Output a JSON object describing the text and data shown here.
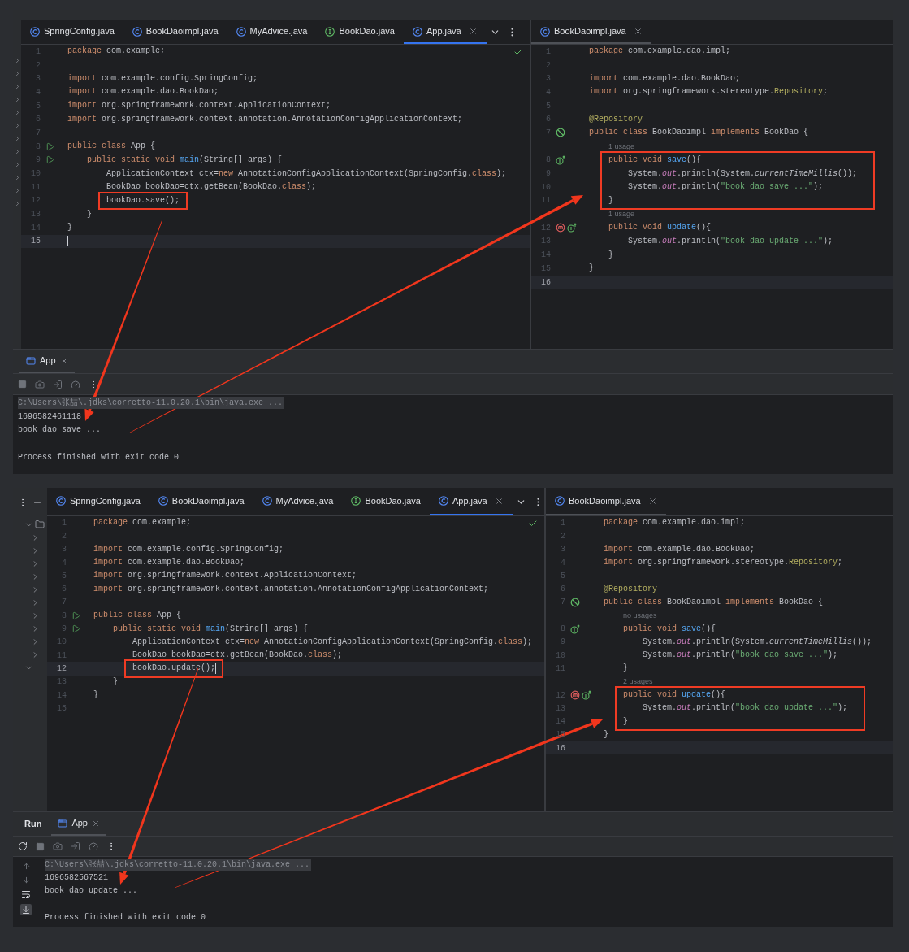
{
  "screens": [
    {
      "project_panel": {
        "kind": "narrow"
      },
      "left_editor": {
        "focused": true,
        "status_ok": true,
        "tabs": [
          {
            "label": "SpringConfig.java",
            "kind": "class",
            "selected": false
          },
          {
            "label": "BookDaoimpl.java",
            "kind": "class",
            "selected": false
          },
          {
            "label": "MyAdvice.java",
            "kind": "class",
            "selected": false
          },
          {
            "label": "BookDao.java",
            "kind": "interface",
            "selected": false
          },
          {
            "label": "App.java",
            "kind": "class",
            "selected": true
          }
        ],
        "lines": [
          {
            "kind": "code",
            "number": "1",
            "current": false,
            "boxed": false,
            "segments": [
              {
                "kind": "kw",
                "text": "package "
              },
              {
                "kind": "plain",
                "text": "com.example;"
              }
            ]
          },
          {
            "kind": "code",
            "number": "2",
            "current": false,
            "boxed": false
          },
          {
            "kind": "code",
            "number": "3",
            "current": false,
            "boxed": false,
            "segments": [
              {
                "kind": "kw",
                "text": "import "
              },
              {
                "kind": "plain",
                "text": "com.example.config.SpringConfig;"
              }
            ]
          },
          {
            "kind": "code",
            "number": "4",
            "current": false,
            "boxed": false,
            "segments": [
              {
                "kind": "kw",
                "text": "import "
              },
              {
                "kind": "plain",
                "text": "com.example.dao.BookDao;"
              }
            ]
          },
          {
            "kind": "code",
            "number": "5",
            "current": false,
            "boxed": false,
            "segments": [
              {
                "kind": "kw",
                "text": "import "
              },
              {
                "kind": "plain",
                "text": "org.springframework.context.ApplicationContext;"
              }
            ]
          },
          {
            "kind": "code",
            "number": "6",
            "current": false,
            "boxed": false,
            "segments": [
              {
                "kind": "kw",
                "text": "import "
              },
              {
                "kind": "plain",
                "text": "org.springframework.context.annotation.AnnotationConfigApplicationContext;"
              }
            ]
          },
          {
            "kind": "code",
            "number": "7",
            "current": false,
            "boxed": false
          },
          {
            "kind": "code",
            "number": "8",
            "current": false,
            "boxed": false,
            "gutter": [
              {
                "kind": "run"
              }
            ],
            "segments": [
              {
                "kind": "kw",
                "text": "public class "
              },
              {
                "kind": "plain",
                "text": "App {"
              }
            ]
          },
          {
            "kind": "code",
            "number": "9",
            "current": false,
            "boxed": false,
            "gutter": [
              {
                "kind": "run"
              }
            ],
            "segments": [
              {
                "kind": "kw",
                "text": "    public static void "
              },
              {
                "kind": "fn",
                "text": "main"
              },
              {
                "kind": "plain",
                "text": "(String[] args) {"
              }
            ]
          },
          {
            "kind": "code",
            "number": "10",
            "current": false,
            "boxed": false,
            "segments": [
              {
                "kind": "plain",
                "text": "        ApplicationContext ctx="
              },
              {
                "kind": "kw",
                "text": "new "
              },
              {
                "kind": "plain",
                "text": "AnnotationConfigApplicationContext(SpringConfig."
              },
              {
                "kind": "kw",
                "text": "class"
              },
              {
                "kind": "plain",
                "text": ");"
              }
            ]
          },
          {
            "kind": "code",
            "number": "11",
            "current": false,
            "boxed": false,
            "segments": [
              {
                "kind": "plain",
                "text": "        BookDao bookDao=ctx.getBean(BookDao."
              },
              {
                "kind": "kw",
                "text": "class"
              },
              {
                "kind": "plain",
                "text": ");"
              }
            ]
          },
          {
            "kind": "code",
            "number": "12",
            "current": false,
            "boxed": true,
            "segments": [
              {
                "kind": "plain",
                "text": "        bookDao.save();"
              }
            ]
          },
          {
            "kind": "code",
            "number": "13",
            "current": false,
            "boxed": false,
            "segments": [
              {
                "kind": "plain",
                "text": "    }"
              }
            ]
          },
          {
            "kind": "code",
            "number": "14",
            "current": false,
            "boxed": false,
            "segments": [
              {
                "kind": "plain",
                "text": "}"
              }
            ]
          },
          {
            "kind": "code",
            "number": "15",
            "current": true,
            "boxed": false
          }
        ]
      },
      "right_editor": {
        "focused": false,
        "status_ok": false,
        "tabs": [
          {
            "label": "BookDaoimpl.java",
            "kind": "class",
            "selected": true
          }
        ],
        "lines": [
          {
            "kind": "code",
            "number": "1",
            "current": false,
            "boxed": false,
            "segments": [
              {
                "kind": "kw",
                "text": "package "
              },
              {
                "kind": "plain",
                "text": "com.example.dao.impl;"
              }
            ]
          },
          {
            "kind": "code",
            "number": "2",
            "current": false,
            "boxed": false
          },
          {
            "kind": "code",
            "number": "3",
            "current": false,
            "boxed": false,
            "segments": [
              {
                "kind": "kw",
                "text": "import "
              },
              {
                "kind": "plain",
                "text": "com.example.dao.BookDao;"
              }
            ]
          },
          {
            "kind": "code",
            "number": "4",
            "current": false,
            "boxed": false,
            "segments": [
              {
                "kind": "kw",
                "text": "import "
              },
              {
                "kind": "plain",
                "text": "org.springframework.stereotype."
              },
              {
                "kind": "ann",
                "text": "Repository"
              },
              {
                "kind": "plain",
                "text": ";"
              }
            ]
          },
          {
            "kind": "code",
            "number": "5",
            "current": false,
            "boxed": false
          },
          {
            "kind": "code",
            "number": "6",
            "current": false,
            "boxed": false,
            "segments": [
              {
                "kind": "ann",
                "text": "@Repository"
              }
            ]
          },
          {
            "kind": "code",
            "number": "7",
            "current": false,
            "boxed": false,
            "gutter": [
              {
                "kind": "bean"
              }
            ],
            "segments": [
              {
                "kind": "kw",
                "text": "public class "
              },
              {
                "kind": "plain",
                "text": "BookDaoimpl "
              },
              {
                "kind": "kw",
                "text": "implements "
              },
              {
                "kind": "plain",
                "text": "BookDao {"
              }
            ]
          },
          {
            "kind": "hint",
            "text": "1 usage"
          },
          {
            "kind": "code",
            "number": "8",
            "current": false,
            "boxed": true,
            "gutter": [
              {
                "kind": "impl"
              }
            ],
            "segments": [
              {
                "kind": "kw",
                "text": "    public void "
              },
              {
                "kind": "fn",
                "text": "save"
              },
              {
                "kind": "plain",
                "text": "(){"
              }
            ]
          },
          {
            "kind": "code",
            "number": "9",
            "current": false,
            "boxed": true,
            "segments": [
              {
                "kind": "plain",
                "text": "        System."
              },
              {
                "kind": "field",
                "text": "out"
              },
              {
                "kind": "plain",
                "text": ".println(System."
              },
              {
                "kind": "static",
                "text": "currentTimeMillis"
              },
              {
                "kind": "plain",
                "text": "());"
              }
            ]
          },
          {
            "kind": "code",
            "number": "10",
            "current": false,
            "boxed": true,
            "segments": [
              {
                "kind": "plain",
                "text": "        System."
              },
              {
                "kind": "field",
                "text": "out"
              },
              {
                "kind": "plain",
                "text": ".println("
              },
              {
                "kind": "str",
                "text": "\"book dao save ...\""
              },
              {
                "kind": "plain",
                "text": ");"
              }
            ]
          },
          {
            "kind": "code",
            "number": "11",
            "current": false,
            "boxed": true,
            "segments": [
              {
                "kind": "plain",
                "text": "    }"
              }
            ]
          },
          {
            "kind": "hint",
            "text": "1 usage"
          },
          {
            "kind": "code",
            "number": "12",
            "current": false,
            "boxed": false,
            "gutter": [
              {
                "kind": "override"
              },
              {
                "kind": "impl"
              }
            ],
            "segments": [
              {
                "kind": "kw",
                "text": "    public void "
              },
              {
                "kind": "fn",
                "text": "update"
              },
              {
                "kind": "plain",
                "text": "(){"
              }
            ]
          },
          {
            "kind": "code",
            "number": "13",
            "current": false,
            "boxed": false,
            "segments": [
              {
                "kind": "plain",
                "text": "        System."
              },
              {
                "kind": "field",
                "text": "out"
              },
              {
                "kind": "plain",
                "text": ".println("
              },
              {
                "kind": "str",
                "text": "\"book dao update ...\""
              },
              {
                "kind": "plain",
                "text": ");"
              }
            ]
          },
          {
            "kind": "code",
            "number": "14",
            "current": false,
            "boxed": false,
            "segments": [
              {
                "kind": "plain",
                "text": "    }"
              }
            ]
          },
          {
            "kind": "code",
            "number": "15",
            "current": false,
            "boxed": false,
            "segments": [
              {
                "kind": "plain",
                "text": "}"
              }
            ]
          },
          {
            "kind": "code",
            "number": "16",
            "current": true,
            "boxed": false
          }
        ]
      },
      "run_panel": {
        "side_toolbar": false,
        "tabs": [
          {
            "label": "App",
            "selected": true
          }
        ],
        "output": [
          {
            "kind": "command",
            "text": "C:\\Users\\张喆\\.jdks\\corretto-11.0.20.1\\bin\\java.exe ..."
          },
          {
            "kind": "text",
            "text": "1696582461118"
          },
          {
            "kind": "text",
            "text": "book dao save ..."
          },
          {
            "kind": "blank"
          },
          {
            "kind": "text",
            "text": "Process finished with exit code 0"
          }
        ]
      }
    },
    {
      "project_panel": {
        "kind": "wide"
      },
      "left_editor": {
        "focused": true,
        "status_ok": true,
        "tabs": [
          {
            "label": "SpringConfig.java",
            "kind": "class",
            "selected": false
          },
          {
            "label": "BookDaoimpl.java",
            "kind": "class",
            "selected": false
          },
          {
            "label": "MyAdvice.java",
            "kind": "class",
            "selected": false
          },
          {
            "label": "BookDao.java",
            "kind": "interface",
            "selected": false
          },
          {
            "label": "App.java",
            "kind": "class",
            "selected": true
          }
        ],
        "lines": [
          {
            "kind": "code",
            "number": "1",
            "current": false,
            "boxed": false,
            "segments": [
              {
                "kind": "kw",
                "text": "package "
              },
              {
                "kind": "plain",
                "text": "com.example;"
              }
            ]
          },
          {
            "kind": "code",
            "number": "2",
            "current": false,
            "boxed": false
          },
          {
            "kind": "code",
            "number": "3",
            "current": false,
            "boxed": false,
            "segments": [
              {
                "kind": "kw",
                "text": "import "
              },
              {
                "kind": "plain",
                "text": "com.example.config.SpringConfig;"
              }
            ]
          },
          {
            "kind": "code",
            "number": "4",
            "current": false,
            "boxed": false,
            "segments": [
              {
                "kind": "kw",
                "text": "import "
              },
              {
                "kind": "plain",
                "text": "com.example.dao.BookDao;"
              }
            ]
          },
          {
            "kind": "code",
            "number": "5",
            "current": false,
            "boxed": false,
            "segments": [
              {
                "kind": "kw",
                "text": "import "
              },
              {
                "kind": "plain",
                "text": "org.springframework.context.ApplicationContext;"
              }
            ]
          },
          {
            "kind": "code",
            "number": "6",
            "current": false,
            "boxed": false,
            "segments": [
              {
                "kind": "kw",
                "text": "import "
              },
              {
                "kind": "plain",
                "text": "org.springframework.context.annotation.AnnotationConfigApplicationContext;"
              }
            ]
          },
          {
            "kind": "code",
            "number": "7",
            "current": false,
            "boxed": false
          },
          {
            "kind": "code",
            "number": "8",
            "current": false,
            "boxed": false,
            "gutter": [
              {
                "kind": "run"
              }
            ],
            "segments": [
              {
                "kind": "kw",
                "text": "public class "
              },
              {
                "kind": "plain",
                "text": "App {"
              }
            ]
          },
          {
            "kind": "code",
            "number": "9",
            "current": false,
            "boxed": false,
            "gutter": [
              {
                "kind": "run"
              }
            ],
            "segments": [
              {
                "kind": "kw",
                "text": "    public static void "
              },
              {
                "kind": "fn",
                "text": "main"
              },
              {
                "kind": "plain",
                "text": "(String[] args) {"
              }
            ]
          },
          {
            "kind": "code",
            "number": "10",
            "current": false,
            "boxed": false,
            "segments": [
              {
                "kind": "plain",
                "text": "        ApplicationContext ctx="
              },
              {
                "kind": "kw",
                "text": "new "
              },
              {
                "kind": "plain",
                "text": "AnnotationConfigApplicationContext(SpringConfig."
              },
              {
                "kind": "kw",
                "text": "class"
              },
              {
                "kind": "plain",
                "text": ");"
              }
            ]
          },
          {
            "kind": "code",
            "number": "11",
            "current": false,
            "boxed": false,
            "segments": [
              {
                "kind": "plain",
                "text": "        BookDao bookDao=ctx.getBean(BookDao."
              },
              {
                "kind": "kw",
                "text": "class"
              },
              {
                "kind": "plain",
                "text": ");"
              }
            ]
          },
          {
            "kind": "code",
            "number": "12",
            "current": true,
            "boxed": true,
            "segments": [
              {
                "kind": "plain",
                "text": "        bookDao.update();"
              }
            ]
          },
          {
            "kind": "code",
            "number": "13",
            "current": false,
            "boxed": false,
            "segments": [
              {
                "kind": "plain",
                "text": "    }"
              }
            ]
          },
          {
            "kind": "code",
            "number": "14",
            "current": false,
            "boxed": false,
            "segments": [
              {
                "kind": "plain",
                "text": "}"
              }
            ]
          },
          {
            "kind": "code",
            "number": "15",
            "current": false,
            "boxed": false
          }
        ]
      },
      "right_editor": {
        "focused": false,
        "status_ok": false,
        "tabs": [
          {
            "label": "BookDaoimpl.java",
            "kind": "class",
            "selected": true
          }
        ],
        "lines": [
          {
            "kind": "code",
            "number": "1",
            "current": false,
            "boxed": false,
            "segments": [
              {
                "kind": "kw",
                "text": "package "
              },
              {
                "kind": "plain",
                "text": "com.example.dao.impl;"
              }
            ]
          },
          {
            "kind": "code",
            "number": "2",
            "current": false,
            "boxed": false
          },
          {
            "kind": "code",
            "number": "3",
            "current": false,
            "boxed": false,
            "segments": [
              {
                "kind": "kw",
                "text": "import "
              },
              {
                "kind": "plain",
                "text": "com.example.dao.BookDao;"
              }
            ]
          },
          {
            "kind": "code",
            "number": "4",
            "current": false,
            "boxed": false,
            "segments": [
              {
                "kind": "kw",
                "text": "import "
              },
              {
                "kind": "plain",
                "text": "org.springframework.stereotype."
              },
              {
                "kind": "ann",
                "text": "Repository"
              },
              {
                "kind": "plain",
                "text": ";"
              }
            ]
          },
          {
            "kind": "code",
            "number": "5",
            "current": false,
            "boxed": false
          },
          {
            "kind": "code",
            "number": "6",
            "current": false,
            "boxed": false,
            "segments": [
              {
                "kind": "ann",
                "text": "@Repository"
              }
            ]
          },
          {
            "kind": "code",
            "number": "7",
            "current": false,
            "boxed": false,
            "gutter": [
              {
                "kind": "bean"
              }
            ],
            "segments": [
              {
                "kind": "kw",
                "text": "public class "
              },
              {
                "kind": "plain",
                "text": "BookDaoimpl "
              },
              {
                "kind": "kw",
                "text": "implements "
              },
              {
                "kind": "plain",
                "text": "BookDao {"
              }
            ]
          },
          {
            "kind": "hint",
            "text": "no usages"
          },
          {
            "kind": "code",
            "number": "8",
            "current": false,
            "boxed": false,
            "gutter": [
              {
                "kind": "impl"
              }
            ],
            "segments": [
              {
                "kind": "kw",
                "text": "    public void "
              },
              {
                "kind": "fn",
                "text": "save"
              },
              {
                "kind": "plain",
                "text": "(){"
              }
            ]
          },
          {
            "kind": "code",
            "number": "9",
            "current": false,
            "boxed": false,
            "segments": [
              {
                "kind": "plain",
                "text": "        System."
              },
              {
                "kind": "field",
                "text": "out"
              },
              {
                "kind": "plain",
                "text": ".println(System."
              },
              {
                "kind": "static",
                "text": "currentTimeMillis"
              },
              {
                "kind": "plain",
                "text": "());"
              }
            ]
          },
          {
            "kind": "code",
            "number": "10",
            "current": false,
            "boxed": false,
            "segments": [
              {
                "kind": "plain",
                "text": "        System."
              },
              {
                "kind": "field",
                "text": "out"
              },
              {
                "kind": "plain",
                "text": ".println("
              },
              {
                "kind": "str",
                "text": "\"book dao save ...\""
              },
              {
                "kind": "plain",
                "text": ");"
              }
            ]
          },
          {
            "kind": "code",
            "number": "11",
            "current": false,
            "boxed": false,
            "segments": [
              {
                "kind": "plain",
                "text": "    }"
              }
            ]
          },
          {
            "kind": "hint",
            "text": "2 usages"
          },
          {
            "kind": "code",
            "number": "12",
            "current": false,
            "boxed": true,
            "gutter": [
              {
                "kind": "override"
              },
              {
                "kind": "impl"
              }
            ],
            "segments": [
              {
                "kind": "kw",
                "text": "    public void "
              },
              {
                "kind": "fn",
                "text": "update"
              },
              {
                "kind": "plain",
                "text": "(){"
              }
            ]
          },
          {
            "kind": "code",
            "number": "13",
            "current": false,
            "boxed": true,
            "segments": [
              {
                "kind": "plain",
                "text": "        System."
              },
              {
                "kind": "field",
                "text": "out"
              },
              {
                "kind": "plain",
                "text": ".println("
              },
              {
                "kind": "str",
                "text": "\"book dao update ...\""
              },
              {
                "kind": "plain",
                "text": ");"
              }
            ]
          },
          {
            "kind": "code",
            "number": "14",
            "current": false,
            "boxed": true,
            "segments": [
              {
                "kind": "plain",
                "text": "    }"
              }
            ]
          },
          {
            "kind": "code",
            "number": "15",
            "current": false,
            "boxed": false,
            "segments": [
              {
                "kind": "plain",
                "text": "}"
              }
            ]
          },
          {
            "kind": "code",
            "number": "16",
            "current": true,
            "boxed": false
          }
        ]
      },
      "run_panel": {
        "title": "Run",
        "side_toolbar": true,
        "tabs": [
          {
            "label": "App",
            "selected": true
          }
        ],
        "output": [
          {
            "kind": "command",
            "text": "C:\\Users\\张喆\\.jdks\\corretto-11.0.20.1\\bin\\java.exe ..."
          },
          {
            "kind": "text",
            "text": "1696582567521"
          },
          {
            "kind": "text",
            "text": "book dao update ..."
          },
          {
            "kind": "blank"
          },
          {
            "kind": "text",
            "text": "Process finished with exit code 0"
          }
        ]
      }
    }
  ]
}
